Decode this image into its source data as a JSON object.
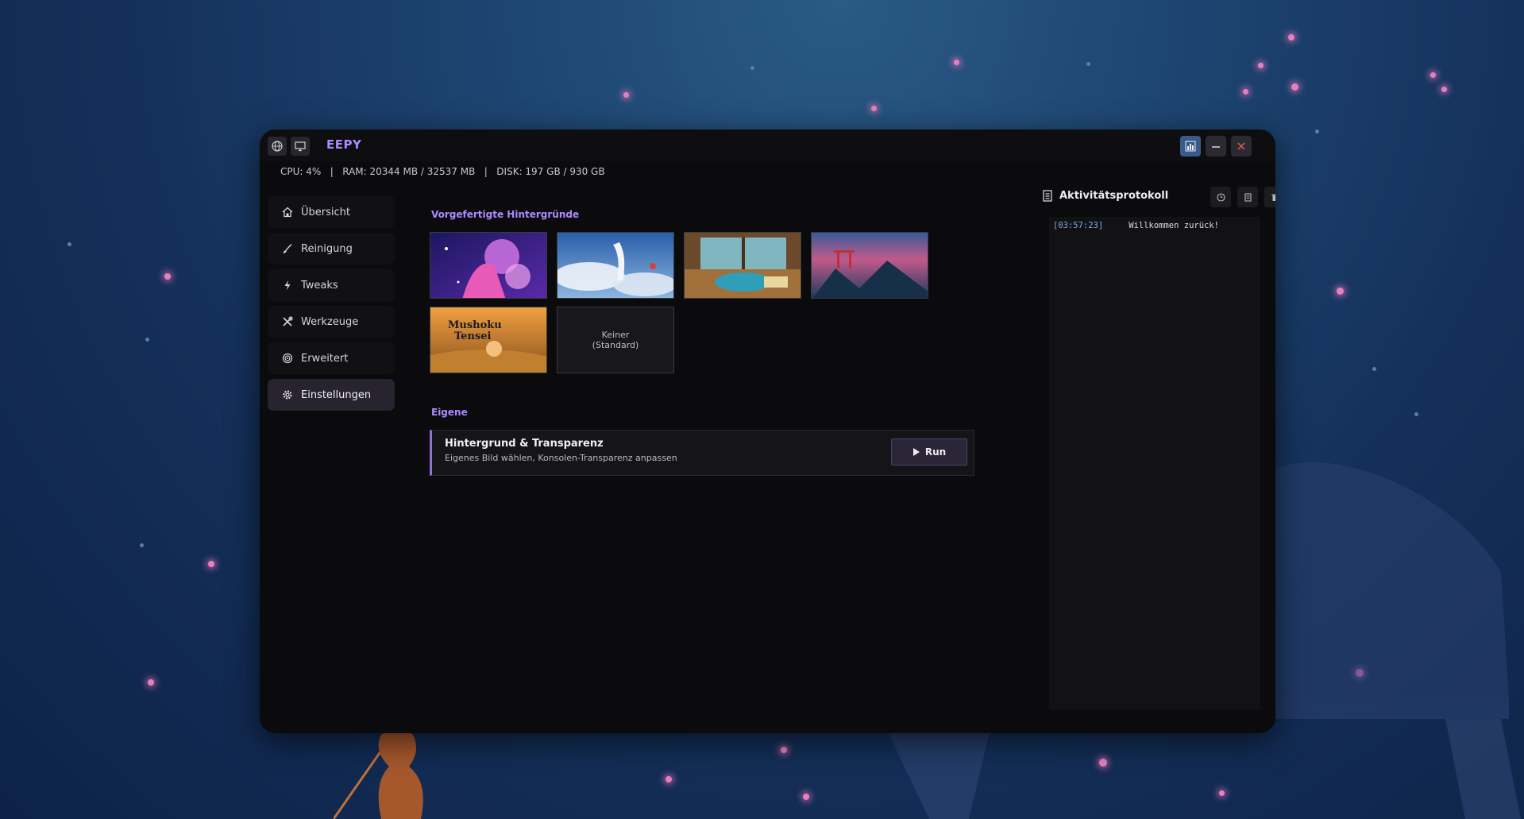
{
  "window": {
    "title": "EEPY",
    "stats": {
      "cpu": "CPU: 4%",
      "ram": "RAM: 20344 MB / 32537 MB",
      "disk": "DISK: 197 GB / 930 GB",
      "separator": "|"
    }
  },
  "sidebar": {
    "items": [
      {
        "label": "Übersicht",
        "icon": "home-icon"
      },
      {
        "label": "Reinigung",
        "icon": "brush-icon"
      },
      {
        "label": "Tweaks",
        "icon": "lightning-icon"
      },
      {
        "label": "Werkzeuge",
        "icon": "tools-icon"
      },
      {
        "label": "Erweitert",
        "icon": "spiral-icon"
      },
      {
        "label": "Einstellungen",
        "icon": "gear-icon",
        "active": true
      }
    ]
  },
  "main": {
    "presets_title": "Vorgefertigte Hintergründe",
    "none_option": {
      "line1": "Keiner",
      "line2": "(Standard)"
    },
    "custom_title": "Eigene",
    "card": {
      "title": "Hintergrund & Transparenz",
      "subtitle": "Eigenes Bild wählen, Konsolen-Transparenz anpassen",
      "run_label": "Run"
    }
  },
  "log": {
    "title": "Aktivitätsprotokoll",
    "entries": [
      {
        "time": "[03:57:23]",
        "message": "Willkommen zurück!"
      }
    ]
  },
  "colors": {
    "accent": "#a98bff",
    "window_bg": "#0b0b0d",
    "close": "#e05a5a"
  }
}
